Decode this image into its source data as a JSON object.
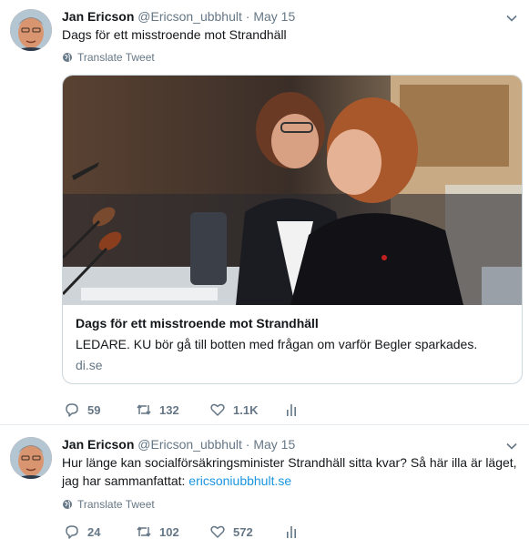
{
  "tweets": [
    {
      "author_name": "Jan Ericson",
      "handle": "@Ericson_ubbhult",
      "dot": "·",
      "date": "May 15",
      "text": "Dags för ett misstroende mot Strandhäll",
      "translate_label": "Translate Tweet",
      "card": {
        "title": "Dags för ett misstroende mot Strandhäll",
        "description": "LEDARE. KU bör gå till botten med frågan om varför Begler sparkades.",
        "domain": "di.se"
      },
      "actions": {
        "replies": "59",
        "retweets": "132",
        "likes": "1.1K"
      }
    },
    {
      "author_name": "Jan Ericson",
      "handle": "@Ericson_ubbhult",
      "dot": "·",
      "date": "May 15",
      "text": "Hur länge kan socialförsäkringsminister Strandhäll sitta kvar? Så här illa är läget, jag har sammanfattat: ",
      "link_text": "ericsoniubbhult.se",
      "translate_label": "Translate Tweet",
      "actions": {
        "replies": "24",
        "retweets": "102",
        "likes": "572"
      }
    }
  ],
  "icons": [
    "caret-down-icon",
    "globe-icon",
    "reply-icon",
    "retweet-icon",
    "like-icon",
    "analytics-icon"
  ],
  "colors": {
    "link": "#1b95e0",
    "secondary": "#657786",
    "border": "#e6ecf0"
  }
}
